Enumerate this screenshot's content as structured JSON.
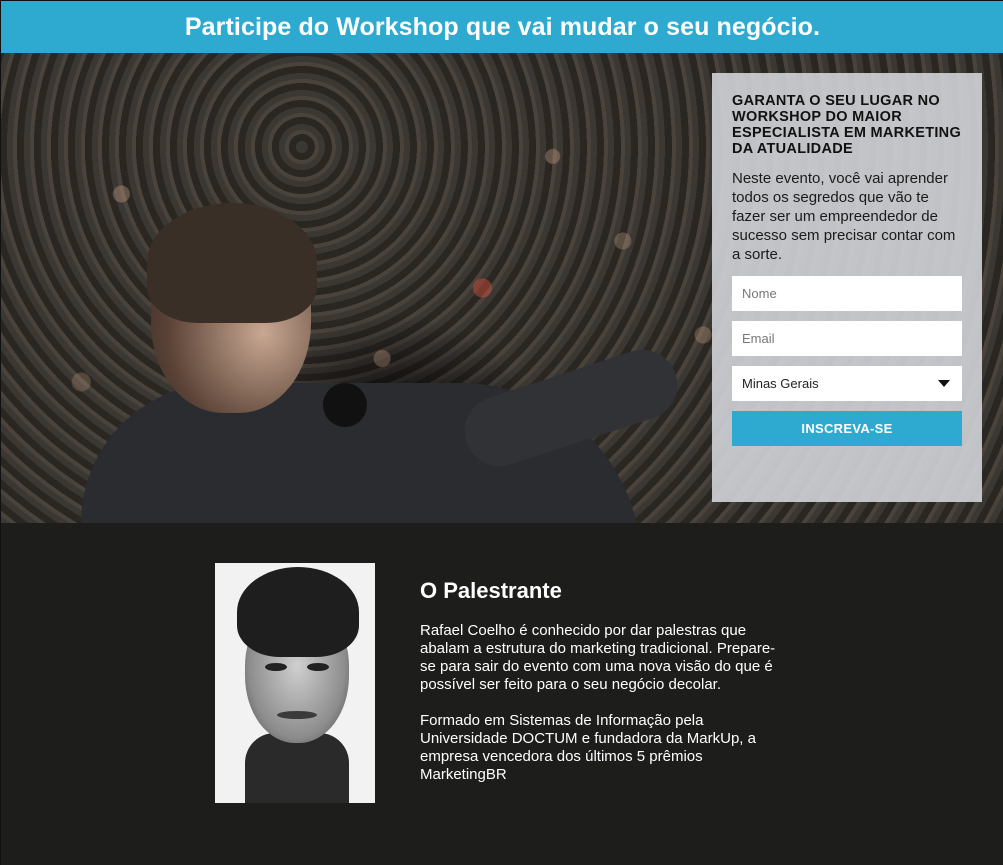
{
  "header": {
    "title": "Participe do Workshop que vai mudar o seu negócio."
  },
  "form": {
    "heading": "GARANTA O SEU LUGAR NO WORKSHOP DO MAIOR ESPECIALISTA EM MARKETING DA ATUALIDADE",
    "description": "Neste evento, você vai aprender todos os segredos que vão te fazer ser um empreendedor de sucesso sem precisar contar com a sorte.",
    "name_placeholder": "Nome",
    "email_placeholder": "Email",
    "state_selected": "Minas Gerais",
    "submit_label": "INSCREVA-SE"
  },
  "speaker": {
    "title": "O Palestrante",
    "bio_1": "Rafael Coelho é conhecido por dar palestras que abalam a estrutura do marketing tradicional. Prepare-se para sair do evento com uma nova visão do que é possível ser feito para o seu negócio decolar.",
    "bio_2": "Formado em Sistemas de Informação pela Universidade DOCTUM e fundadora da MarkUp, a empresa vencedora dos últimos 5 prêmios MarketingBR"
  },
  "colors": {
    "accent": "#2eaad1",
    "dark_bg": "#1d1e1c",
    "card_bg": "#d2d4d8"
  }
}
